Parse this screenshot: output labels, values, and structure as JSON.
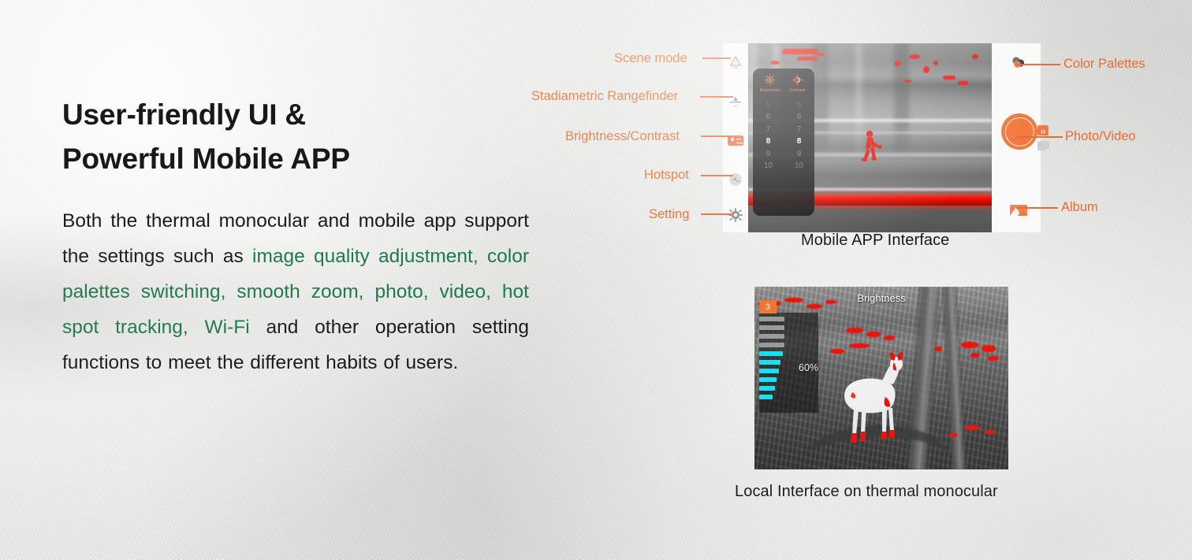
{
  "slide": {
    "headline": "User-friendly UI &\nPowerful Mobile APP",
    "paragraph": {
      "segments": [
        {
          "text": "Both the thermal monocular and mobile app support the settings such as ",
          "highlight": false
        },
        {
          "text": "image quality adjustment, color palettes switching, smooth zoom, photo, video, hot spot tracking, Wi-Fi",
          "highlight": true
        },
        {
          "text": " and other operation setting functions to meet the different habits of users.",
          "highlight": false
        }
      ],
      "full_text": "Both the thermal monocular and mobile app support the settings such as image quality adjustment, color palettes switching, smooth zoom, photo, video, hot spot tracking, Wi-Fi and other operation setting functions to meet the different habits of users."
    }
  },
  "colors": {
    "accent_orange": "#ec6b2d",
    "highlight_green": "#1d7a4e",
    "shutter_orange": "#f2793f",
    "badge_orange": "#ef7733",
    "slider_active_cyan": "#18e0f0",
    "slider_inactive_gray": "#9a9a9a",
    "thermal_red": "#e8150b",
    "background": "#e9e9e7",
    "text_dark": "#181818"
  },
  "mobile_app": {
    "caption": "Mobile APP   Interface",
    "left_callouts": [
      {
        "label": "Scene mode",
        "icon": "scene-mode-icon"
      },
      {
        "label": "Stadiametric Rangefinder",
        "icon": "rangefinder-icon"
      },
      {
        "label": "Brightness/Contrast",
        "icon": "brightness-contrast-icon"
      },
      {
        "label": "Hotspot",
        "icon": "hotspot-icon"
      },
      {
        "label": "Setting",
        "icon": "gear-icon"
      }
    ],
    "right_callouts": [
      {
        "label": "Color Palettes",
        "icon": "color-palettes-icon"
      },
      {
        "label": "Photo/Video",
        "icon": "shutter-icon"
      },
      {
        "label": "Album",
        "icon": "album-icon"
      }
    ],
    "overlay_panel": {
      "brightness": {
        "label": "Brightness",
        "icon": "brightness-sun-icon",
        "values": [
          "5",
          "6",
          "7",
          "8",
          "9",
          "10"
        ],
        "selected": "8"
      },
      "contrast": {
        "label": "Contrast",
        "icon": "contrast-half-circle-icon",
        "values": [
          "5",
          "6",
          "7",
          "8",
          "9",
          "10"
        ],
        "selected": "8"
      }
    },
    "camera_modes": {
      "photo": "photo-mode-icon",
      "video": "video-mode-icon"
    }
  },
  "local_interface": {
    "caption": "Local Interface on thermal monocular",
    "osd": {
      "title": "Brightness",
      "badge": "3",
      "percent": "60%",
      "bar_count": 10,
      "active_bars": 6,
      "inactive_bars": 4
    }
  }
}
